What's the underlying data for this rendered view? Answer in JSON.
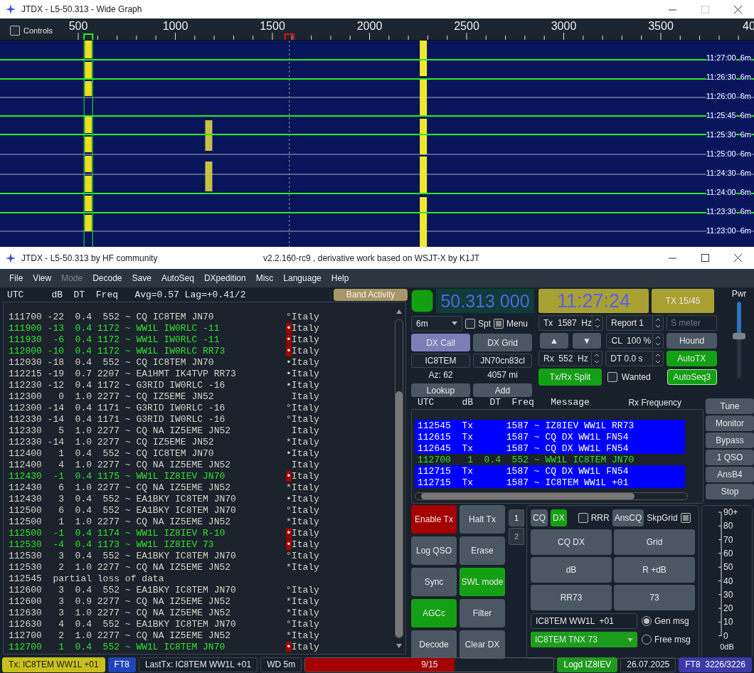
{
  "wide_graph": {
    "title": "JTDX - L5-50.313 - Wide Graph",
    "maximize_disabled": true,
    "controls": {
      "label": "Controls",
      "checked": false
    },
    "scale_labels": [
      "500",
      "1000",
      "1500",
      "2000",
      "2500",
      "3000",
      "3500",
      "40"
    ],
    "time_marks": [
      {
        "time": "11:27:00",
        "band": "6m"
      },
      {
        "time": "11:26:30",
        "band": "6m"
      },
      {
        "time": "11:26:00",
        "band": "6m"
      },
      {
        "time": "11:25:45",
        "band": "6m"
      },
      {
        "time": "11:25:30",
        "band": "6m"
      },
      {
        "time": "11:25:00",
        "band": "6m"
      },
      {
        "time": "11:24:30",
        "band": "6m"
      },
      {
        "time": "11:24:00",
        "band": "6m"
      },
      {
        "time": "11:23:30",
        "band": "6m"
      },
      {
        "time": "11:23:00",
        "band": "6m"
      }
    ]
  },
  "main_window": {
    "title": "JTDX - L5-50.313  by HF community",
    "subtitle": "v2.2.160-rc9 , derivative work based on WSJT-X by K1JT",
    "maximize_disabled": false
  },
  "menu": [
    {
      "label": "File",
      "disabled": false
    },
    {
      "label": "View",
      "disabled": false
    },
    {
      "label": "Mode",
      "disabled": true
    },
    {
      "label": "Decode",
      "disabled": false
    },
    {
      "label": "Save",
      "disabled": false
    },
    {
      "label": "AutoSeq",
      "disabled": false
    },
    {
      "label": "DXpedition",
      "disabled": false
    },
    {
      "label": "Misc",
      "disabled": false
    },
    {
      "label": "Language",
      "disabled": false
    },
    {
      "label": "Help",
      "disabled": false
    }
  ],
  "decode_header": {
    "columns": [
      "UTC",
      "dB",
      "DT",
      "Freq"
    ],
    "stats": "Avg=0.57 Lag=+0.41/2",
    "button": "Band Activity"
  },
  "decode_rows": [
    {
      "line": "111700 -22  0.4  552 ~ CQ IC8TEM JN70",
      "mark": "°",
      "country": "Italy",
      "addressed": false
    },
    {
      "line": "111900 -13  0.4 1172 ~ WW1L IW0RLC -11",
      "mark": "•",
      "country": "Italy",
      "addressed": true
    },
    {
      "line": "111930  -6  0.4 1172 ~ WW1L IW0RLC -11",
      "mark": "•",
      "country": "Italy",
      "addressed": true
    },
    {
      "line": "112000 -10  0.4 1172 ~ WW1L IW0RLC RR73",
      "mark": "•",
      "country": "Italy",
      "addressed": true
    },
    {
      "line": "112030 -18  0.4  552 ~ CQ IC8TEM JN70",
      "mark": "•",
      "country": "Italy",
      "addressed": false
    },
    {
      "line": "112215 -19  0.7 2207 ~ EA1HMT IK4TVP RR73",
      "mark": "•",
      "country": "Italy",
      "addressed": false
    },
    {
      "line": "112230 -12  0.4 1172 ~ G3RID IW0RLC -16",
      "mark": "•",
      "country": "Italy",
      "addressed": false
    },
    {
      "line": "112300   0  1.0 2277 ~ CQ IZ5EME JN52",
      "country": "Italy",
      "addressed": false
    },
    {
      "line": "112300 -14  0.4 1171 ~ G3RID IW0RLC -16",
      "mark": "°",
      "country": "Italy",
      "addressed": false
    },
    {
      "line": "112330 -14  0.4 1171 ~ G3RID IW0RLC -16",
      "mark": "°",
      "country": "Italy",
      "addressed": false
    },
    {
      "line": "112330   5  1.0 2277 ~ CQ NA IZ5EME JN52",
      "country": "Italy",
      "addressed": false
    },
    {
      "line": "112330 -14  1.0 2277 ~ CQ IZ5EME JN52",
      "mark": "*",
      "country": "Italy",
      "addressed": false
    },
    {
      "line": "112400   1  0.4  552 ~ CQ IC8TEM JN70",
      "mark": "•",
      "country": "Italy",
      "addressed": false
    },
    {
      "line": "112400   4  1.0 2277 ~ CQ NA IZ5EME JN52",
      "country": "Italy",
      "addressed": false
    },
    {
      "line": "112430  -1  0.4 1175 ~ WW1L IZ8IEV JN70",
      "mark": "•",
      "country": "Italy",
      "addressed": true
    },
    {
      "line": "112430   6  1.0 2277 ~ CQ NA IZ5EME JN52",
      "mark": "*",
      "country": "Italy",
      "addressed": false
    },
    {
      "line": "112430   3  0.4  552 ~ EA1BKY IC8TEM JN70",
      "mark": "•",
      "country": "Italy",
      "addressed": false
    },
    {
      "line": "112500   6  0.4  552 ~ EA1BKY IC8TEM JN70",
      "mark": "°",
      "country": "Italy",
      "addressed": false
    },
    {
      "line": "112500   1  1.0 2277 ~ CQ NA IZ5EME JN52",
      "mark": "*",
      "country": "Italy",
      "addressed": false
    },
    {
      "line": "112500  -1  0.4 1174 ~ WW1L IZ8IEV R-10",
      "mark": "•",
      "country": "Italy",
      "addressed": true
    },
    {
      "line": "112530  -4  0.4 1173 ~ WW1L IZ8IEV 73",
      "mark": "•",
      "country": "Italy",
      "addressed": true
    },
    {
      "line": "112530   3  0.4  552 ~ EA1BKY IC8TEM JN70",
      "mark": "°",
      "country": "Italy",
      "addressed": false
    },
    {
      "line": "112530   2  1.0 2277 ~ CQ NA IZ5EME JN52",
      "mark": "*",
      "country": "Italy",
      "addressed": false
    },
    {
      "line": "112545  partial loss of data",
      "addressed": false
    },
    {
      "line": "112600   3  0.4  552 ~ EA1BKY IC8TEM JN70",
      "mark": "°",
      "country": "Italy",
      "addressed": false
    },
    {
      "line": "112600   3  0.9 2277 ~ CQ NA IZ5EME JN52",
      "mark": "*",
      "country": "Italy",
      "addressed": false
    },
    {
      "line": "112630   3  1.0 2277 ~ CQ NA IZ5EME JN52",
      "mark": "*",
      "country": "Italy",
      "addressed": false
    },
    {
      "line": "112630   4  0.4  552 ~ EA1BKY IC8TEM JN70",
      "mark": "°",
      "country": "Italy",
      "addressed": false
    },
    {
      "line": "112700   2  1.0 2277 ~ CQ NA IZ5EME JN52",
      "mark": "*",
      "country": "Italy",
      "addressed": false
    },
    {
      "line": "112700   1  0.4  552 ~ WW1L IC8TEM JN70",
      "mark": "•",
      "country": "Italy",
      "addressed": true
    }
  ],
  "frequency": "50.313 000",
  "clock": "11:27:24",
  "tx_period": "TX 15/45",
  "power": {
    "label": "Pwr",
    "level": 0.56
  },
  "band": "6m",
  "spot": {
    "label": "Spt",
    "checked": false
  },
  "menu_toggle": {
    "label": "Menu",
    "checked": true
  },
  "dx": {
    "call_button": "DX Call",
    "call_highlighted": true,
    "grid_button": "DX Grid",
    "call": "IC8TEM",
    "grid": "JN70cn83cl",
    "azimuth": "Az: 62",
    "distance": "4057 mi",
    "lookup": "Lookup",
    "add": "Add"
  },
  "spinboxes": {
    "tx_freq": "Tx  1587  Hz",
    "report": "Report 1",
    "cl": "CL  100 %",
    "rx_freq": "Rx  552  Hz",
    "dt": "DT 0.0 s"
  },
  "s_meter_placeholder": "S meter",
  "tx_arrows": [
    "▲",
    "▼"
  ],
  "toggles": {
    "hound": {
      "label": "Hound",
      "on": false
    },
    "autotx": {
      "label": "AutoTX",
      "on": true
    },
    "split": {
      "label": "Tx/Rx Split",
      "on": true
    },
    "wanted": {
      "label": "Wanted",
      "checked": false
    },
    "autoseq": {
      "label": "AutoSeq3",
      "on": true
    }
  },
  "rx_table": {
    "columns": [
      "UTC",
      "dB",
      "DT",
      "Freq",
      "Message",
      "Rx Frequency"
    ],
    "rows": [
      {
        "line": "112545  Tx      1587 ~ IZ8IEV WW1L RR73",
        "kind": "tx"
      },
      {
        "line": "112615  Tx      1587 ~ CQ DX WW1L FN54",
        "kind": "tx"
      },
      {
        "line": "112645  Tx      1587 ~ CQ DX WW1L FN54",
        "kind": "tx"
      },
      {
        "line": "112700   1  0.4  552 ~ WW1L IC8TEM JN70",
        "kind": "rx"
      },
      {
        "line": "112715  Tx      1587 ~ CQ DX WW1L FN54",
        "kind": "tx"
      },
      {
        "line": "112715  Tx      1587 ~ IC8TEM WW1L +01",
        "kind": "tx"
      }
    ]
  },
  "side_buttons": [
    "Tune",
    "Monitor",
    "Bypass",
    "1 QSO",
    "AnsB4",
    "Stop"
  ],
  "control_buttons": [
    {
      "label": "Enable Tx",
      "kind": "enable",
      "on": true
    },
    {
      "label": "Halt Tx",
      "kind": "normal",
      "on": false
    },
    {
      "label": "Log QSO",
      "kind": "normal",
      "on": false
    },
    {
      "label": "Erase",
      "kind": "normal",
      "on": false
    },
    {
      "label": "Sync",
      "kind": "normal",
      "on": false
    },
    {
      "label": "SWL mode",
      "kind": "normal",
      "on": true
    },
    {
      "label": "AGCc",
      "kind": "normal",
      "on": true
    },
    {
      "label": "Filter",
      "kind": "normal",
      "on": false
    },
    {
      "label": "Decode",
      "kind": "normal",
      "on": false
    },
    {
      "label": "Clear DX",
      "kind": "normal",
      "on": false
    }
  ],
  "msg_tabs": [
    {
      "label": "1",
      "selected": true
    },
    {
      "label": "2",
      "selected": false
    }
  ],
  "msg_panel": {
    "modes": [
      {
        "label": "CQ",
        "selected": false
      },
      {
        "label": "DX",
        "selected": true
      }
    ],
    "rrr": {
      "label": "RRR",
      "checked": false
    },
    "anscq": "AnsCQ",
    "skip_grid": {
      "label": "SkpGrid",
      "checked": true
    },
    "messages": [
      "CQ DX",
      "Grid",
      "dB",
      "R +dB",
      "RR73",
      "73"
    ],
    "gen_text": "IC8TEM WW1L  +01",
    "free_text": "IC8TEM TNX 73",
    "radios": [
      {
        "label": "Gen msg",
        "selected": true
      },
      {
        "label": "Free msg",
        "selected": false
      }
    ]
  },
  "meter": {
    "labels": [
      "90+",
      "80",
      "70",
      "60",
      "50",
      "40",
      "30",
      "20",
      "10",
      "0"
    ],
    "unit": "0dB"
  },
  "status_bar": [
    {
      "kind": "label",
      "text": "Tx: IC8TEM WW1L +01",
      "color": "#c8bf1e"
    },
    {
      "kind": "label",
      "text": "FT8",
      "color": "#1f45b8"
    },
    {
      "kind": "label",
      "text": "LastTx: IC8TEM WW1L +01"
    },
    {
      "kind": "label",
      "text": "WD 5m"
    },
    {
      "kind": "progress",
      "text": "9/15",
      "level": 0.6
    },
    {
      "kind": "label",
      "text": "Logd IZ8IEV",
      "color": "#1f9a1f"
    },
    {
      "kind": "label",
      "text": "26.07.2025"
    },
    {
      "kind": "label",
      "text": "FT8  3226/3226",
      "color": "#3a3aa8"
    }
  ]
}
